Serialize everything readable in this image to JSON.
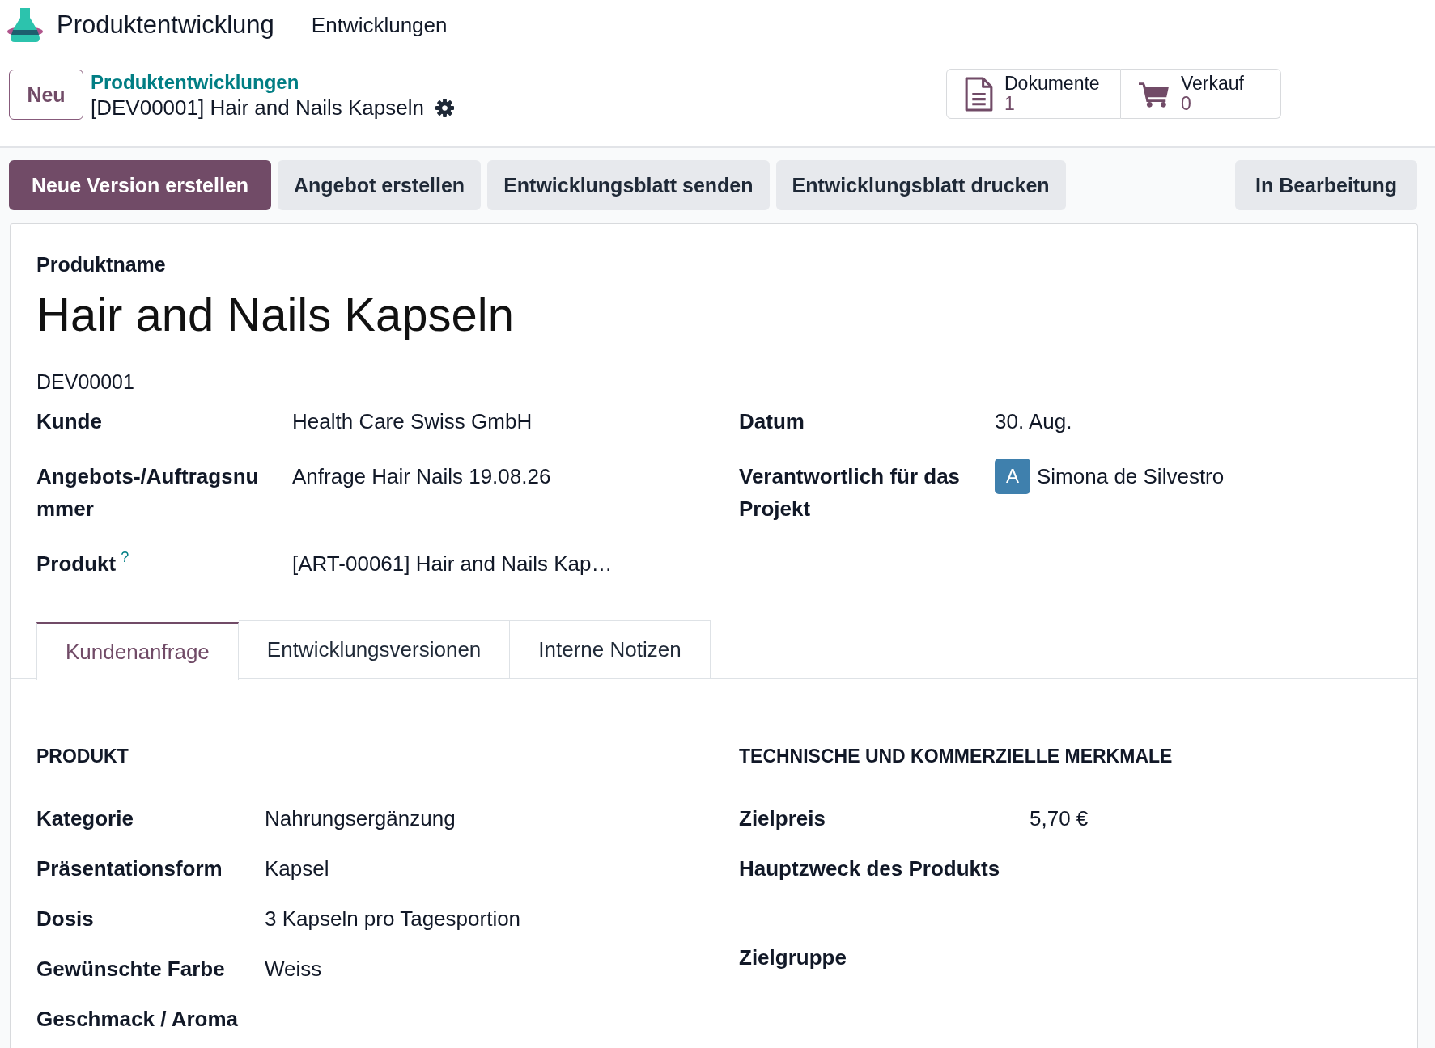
{
  "top_bar": {
    "app_name": "Produktentwicklung",
    "menu": [
      {
        "label": "Entwicklungen"
      }
    ]
  },
  "control_panel": {
    "new_button": "Neu",
    "breadcrumb": {
      "parent": "Produktentwicklungen",
      "current": "[DEV00001] Hair and Nails Kapseln"
    },
    "stat_buttons": [
      {
        "kind": "document",
        "label": "Dokumente",
        "value": "1"
      },
      {
        "kind": "cart",
        "label": "Verkauf",
        "value": "0"
      }
    ]
  },
  "action_buttons": [
    {
      "kind": "primary",
      "label": "Neue Version erstellen"
    },
    {
      "kind": "secondary",
      "label": "Angebot erstellen"
    },
    {
      "kind": "secondary",
      "label": "Entwicklungsblatt senden"
    },
    {
      "kind": "secondary",
      "label": "Entwicklungsblatt drucken"
    }
  ],
  "status": {
    "label": "In Bearbeitung"
  },
  "form": {
    "name_label": "Produktname",
    "name": "Hair and Nails Kapseln",
    "reference": "DEV00001",
    "fields_left": [
      {
        "label": "Kunde",
        "value": "Health Care Swiss GmbH"
      },
      {
        "label": "Angebots-/Auftragsnummer",
        "value": "Anfrage Hair Nails 19.08.26"
      },
      {
        "label": "Produkt",
        "help": "?",
        "value": "[ART-00061] Hair and Nails Kap…"
      }
    ],
    "fields_right": [
      {
        "label": "Datum",
        "value": "30. Aug."
      },
      {
        "label": "Verantwortlich für das Projekt",
        "avatar": "A",
        "value": "Simona de Silvestro"
      }
    ]
  },
  "tabs": [
    {
      "label": "Kundenanfrage",
      "selected": true
    },
    {
      "label": "Entwicklungsversionen",
      "selected": false
    },
    {
      "label": "Interne Notizen",
      "selected": false
    }
  ],
  "tab_content": {
    "sections": [
      {
        "title": "PRODUKT",
        "fields": [
          {
            "kind": "line",
            "label": "Kategorie",
            "value": "Nahrungsergänzung"
          },
          {
            "kind": "line",
            "label": "Präsentationsform",
            "value": "Kapsel"
          },
          {
            "kind": "line",
            "label": "Dosis",
            "value": "3 Kapseln pro Tagesportion"
          },
          {
            "kind": "line",
            "label": "Gewünschte Farbe",
            "value": "Weiss"
          },
          {
            "kind": "line",
            "label": "Geschmack / Aroma"
          }
        ]
      },
      {
        "title": "TECHNISCHE UND KOMMERZIELLE MERKMALE",
        "fields": [
          {
            "kind": "line",
            "label": "Zielpreis",
            "value": "5,70 €"
          },
          {
            "kind": "multiline",
            "label": "Hauptzweck des Produkts"
          },
          {
            "kind": "line",
            "label": "Zielgruppe"
          }
        ]
      }
    ]
  }
}
